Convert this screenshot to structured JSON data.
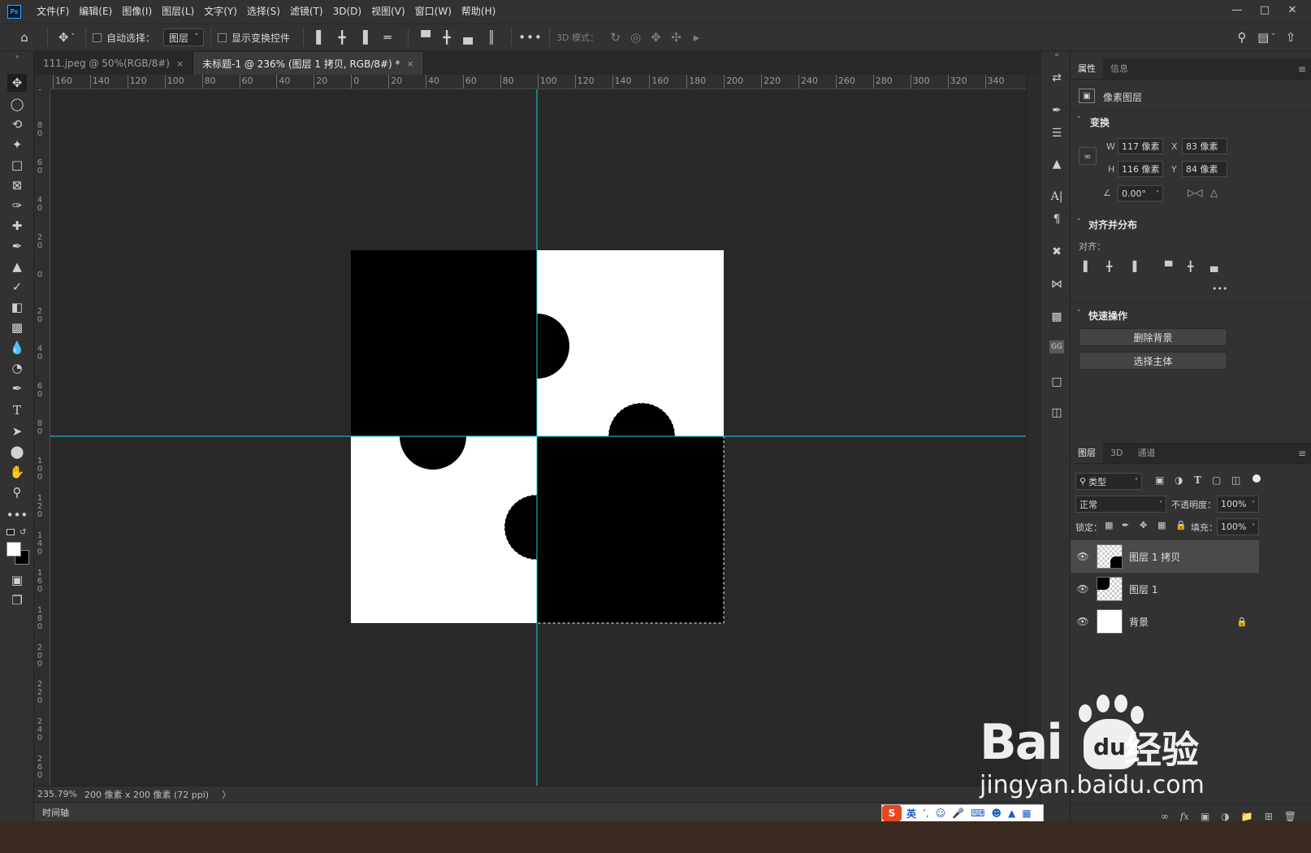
{
  "menu": {
    "items": [
      "文件(F)",
      "编辑(E)",
      "图像(I)",
      "图层(L)",
      "文字(Y)",
      "选择(S)",
      "滤镜(T)",
      "3D(D)",
      "视图(V)",
      "窗口(W)",
      "帮助(H)"
    ],
    "app_icon": "Ps"
  },
  "options": {
    "auto_select_label": "自动选择：",
    "auto_select_target": "图层",
    "show_transform_label": "显示变换控件",
    "mode_3d_label": "3D 模式："
  },
  "tabs": [
    {
      "label": "111.jpeg @ 50%(RGB/8#)",
      "close": "×"
    },
    {
      "label": "未标题-1 @ 236% (图层 1 拷贝, RGB/8#) *",
      "close": "×"
    }
  ],
  "ruler": {
    "top_labels": [
      "160",
      "140",
      "120",
      "100",
      "80",
      "60",
      "40",
      "20",
      "0",
      "20",
      "40",
      "60",
      "80",
      "100",
      "120",
      "140",
      "160",
      "180",
      "200",
      "220",
      "240",
      "260",
      "280",
      "300",
      "320",
      "340"
    ],
    "left_labels": [
      "0",
      "8 0",
      "6 0",
      "4 0",
      "2 0",
      "0",
      "2 0",
      "4 0",
      "6 0",
      "8 0",
      "1 0 0",
      "1 2 0",
      "1 4 0",
      "1 6 0",
      "1 8 0",
      "2 0 0",
      "2 2 0",
      "2 4 0",
      "2 6 0"
    ]
  },
  "status": {
    "zoom": "235.79%",
    "doc_info": "200 像素 x 200 像素 (72 ppi)",
    "arrow": "〉"
  },
  "timeline": {
    "label": "时间轴"
  },
  "properties": {
    "tabs": [
      "属性",
      "信息"
    ],
    "layer_type": "像素图层",
    "transform_title": "变换",
    "w_label": "W",
    "w_value": "117 像素",
    "x_label": "X",
    "x_value": "83 像素",
    "h_label": "H",
    "h_value": "116 像素",
    "y_label": "Y",
    "y_value": "84 像素",
    "angle_value": "0.00°",
    "align_title": "对齐并分布",
    "align_label": "对齐：",
    "more": "•••",
    "quick_title": "快速操作",
    "remove_bg": "删除背景",
    "select_subject": "选择主体"
  },
  "layers": {
    "tabs": [
      "图层",
      "3D",
      "通道"
    ],
    "filter_kind": "类型",
    "blend_mode": "正常",
    "opacity_label": "不透明度：",
    "opacity_value": "100%",
    "lock_label": "锁定：",
    "fill_label": "填充：",
    "fill_value": "100%",
    "items": [
      {
        "name": "图层 1 拷贝",
        "selected": true
      },
      {
        "name": "图层 1",
        "selected": false
      },
      {
        "name": "背景",
        "selected": false,
        "locked": true
      }
    ],
    "footer_icons": [
      "link-icon",
      "fx",
      "mask-icon",
      "adjustment-icon",
      "folder-icon",
      "new-layer-icon",
      "trash-icon"
    ],
    "fx_label": "fx"
  },
  "ime": {
    "lang": "英",
    "logo": "S"
  },
  "watermark": {
    "brand": "Bai",
    "brand2": "du",
    "product": "经验",
    "url": "jingyan.baidu.com"
  },
  "colors": {
    "guide": "#18d2e6",
    "accent": "#31a8ff",
    "canvas_bg": "#282828"
  }
}
